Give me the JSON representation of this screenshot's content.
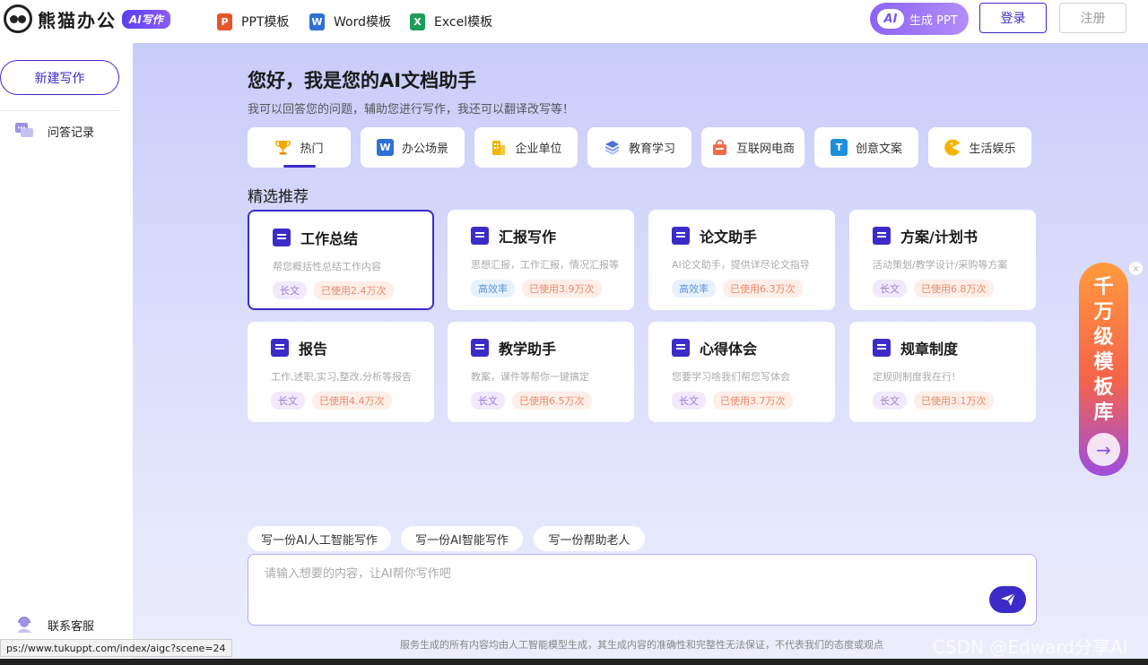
{
  "header": {
    "brand": "熊猫办公",
    "brand_badge": "AI写作",
    "nav": [
      {
        "label": "PPT模板",
        "icon": "ppt-icon",
        "icon_text": "P",
        "color": "#e8552b"
      },
      {
        "label": "Word模板",
        "icon": "word-icon",
        "icon_text": "W",
        "color": "#2e6fd8"
      },
      {
        "label": "Excel模板",
        "icon": "excel-icon",
        "icon_text": "X",
        "color": "#1f9c5a"
      }
    ],
    "gen_ppt": {
      "ai": "AI",
      "label": "生成 PPT"
    },
    "login": "登录",
    "register": "注册"
  },
  "sidebar": {
    "new_button": "新建写作",
    "history": "问答记录",
    "support": "联系客服"
  },
  "main": {
    "greeting": "您好，我是您的AI文档助手",
    "subtitle": "我可以回答您的问题，辅助您进行写作，我还可以翻译改写等！",
    "categories": [
      {
        "label": "热门",
        "icon": "trophy-icon",
        "color": "#f2a900",
        "active": true
      },
      {
        "label": "办公场景",
        "icon": "word-icon",
        "color": "#2e6fd8"
      },
      {
        "label": "企业单位",
        "icon": "building-icon",
        "color": "#f4b400"
      },
      {
        "label": "教育学习",
        "icon": "books-icon",
        "color": "#4a6fd8"
      },
      {
        "label": "互联网电商",
        "icon": "shopping-bag-icon",
        "color": "#f26b4b"
      },
      {
        "label": "创意文案",
        "icon": "text-t-icon",
        "color": "#1f8fdc"
      },
      {
        "label": "生活娱乐",
        "icon": "pacman-icon",
        "color": "#f5b400"
      }
    ],
    "section_title": "精选推荐",
    "cards": [
      {
        "title": "工作总结",
        "desc": "帮您概括性总结工作内容",
        "type": "长文",
        "used": "已使用2.4万次",
        "icon": "edit-note-icon"
      },
      {
        "title": "汇报写作",
        "desc": "思想汇报，工作汇报，情况汇报等",
        "type": "高效率",
        "used": "已使用3.9万次",
        "icon": "document-icon"
      },
      {
        "title": "论文助手",
        "desc": "AI论文助手，提供详尽论文指导",
        "type": "高效率",
        "used": "已使用6.3万次",
        "icon": "bookmark-book-icon"
      },
      {
        "title": "方案/计划书",
        "desc": "活动策划/教学设计/采购等方案",
        "type": "长文",
        "used": "已使用6.8万次",
        "icon": "check-shield-icon"
      },
      {
        "title": "报告",
        "desc": "工作,述职,实习,整改,分析等报告",
        "type": "长文",
        "used": "已使用4.4万次",
        "icon": "clipboard-icon"
      },
      {
        "title": "教学助手",
        "desc": "教案，课件等帮你一键搞定",
        "type": "长文",
        "used": "已使用6.5万次",
        "icon": "teacher-icon"
      },
      {
        "title": "心得体会",
        "desc": "您要学习啥我们帮您写体会",
        "type": "长文",
        "used": "已使用3.7万次",
        "icon": "clipboard-check-icon"
      },
      {
        "title": "规章制度",
        "desc": "定规则制度我在行!",
        "type": "长文",
        "used": "已使用3.1万次",
        "icon": "calendar-month-icon"
      }
    ],
    "suggestions": [
      "写一份AI人工智能写作",
      "写一份AI智能写作",
      "写一份帮助老人"
    ],
    "prompt_placeholder": "请输入想要的内容，让AI帮你写作吧",
    "disclaimer": "服务生成的所有内容均由人工智能模型生成，其生成内容的准确性和完整性无法保证，不代表我们的态度或观点"
  },
  "float_banner": {
    "text": "千万级模板库"
  },
  "status_url": "ps://www.tukuppt.com/index/aigc?scene=24",
  "watermark": "CSDN @Edward分享AI"
}
